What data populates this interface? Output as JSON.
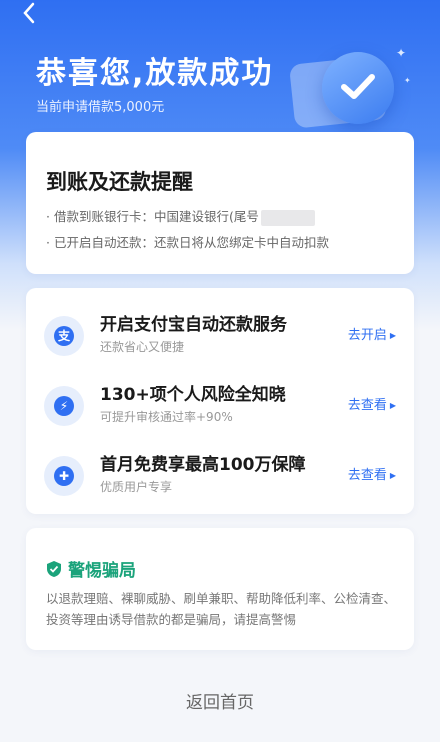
{
  "header": {
    "title": "恭喜您,放款成功",
    "subtitle": "当前申请借款5,000元"
  },
  "notice": {
    "title": "到账及还款提醒",
    "bank_line": "· 借款到账银行卡：中国建设银行(尾号",
    "auto_line": "· 已开启自动还款：还款日将从您绑定卡中自动扣款"
  },
  "services": [
    {
      "title": "开启支付宝自动还款服务",
      "subtitle": "还款省心又便捷",
      "action": "去开启",
      "icon": "alipay-icon",
      "glyph": "支"
    },
    {
      "title": "130+项个人风险全知晓",
      "subtitle": "可提升审核通过率+90%",
      "action": "去查看",
      "icon": "shield-icon",
      "glyph": "⚡"
    },
    {
      "title": "首月免费享最高100万保障",
      "subtitle": "优质用户专享",
      "action": "去查看",
      "icon": "heart-shield-icon",
      "glyph": "✚"
    }
  ],
  "warning": {
    "title": "警惕骗局",
    "text": "以退款理赔、裸聊威胁、刷单兼职、帮助降低利率、公检清查、投资等理由诱导借款的都是骗局，请提高警惕"
  },
  "footer": {
    "home_label": "返回首页"
  },
  "colors": {
    "brand": "#2f6ff2",
    "warning": "#1ba37b"
  }
}
